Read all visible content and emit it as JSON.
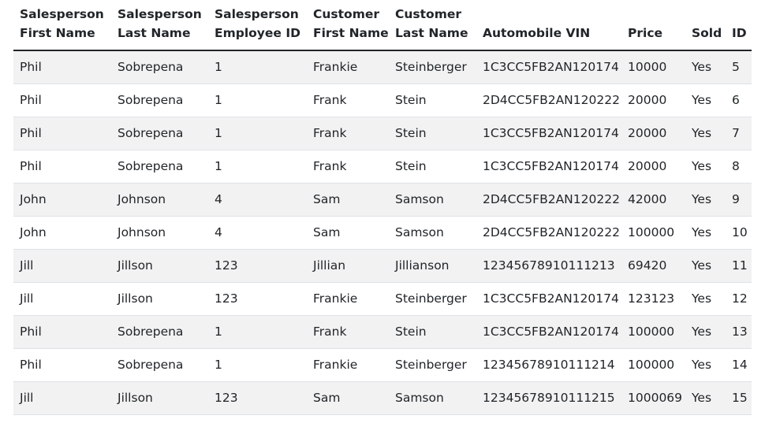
{
  "table": {
    "headers": [
      [
        "Salesperson",
        "First Name"
      ],
      [
        "Salesperson",
        "Last Name"
      ],
      [
        "Salesperson",
        "Employee ID"
      ],
      [
        "Customer",
        "First Name"
      ],
      [
        "Customer",
        "Last Name"
      ],
      [
        "",
        "Automobile VIN"
      ],
      [
        "",
        "Price"
      ],
      [
        "",
        "Sold"
      ],
      [
        "",
        "ID"
      ]
    ],
    "rows": [
      [
        "Phil",
        "Sobrepena",
        "1",
        "Frankie",
        "Steinberger",
        "1C3CC5FB2AN120174",
        "10000",
        "Yes",
        "5"
      ],
      [
        "Phil",
        "Sobrepena",
        "1",
        "Frank",
        "Stein",
        "2D4CC5FB2AN120222",
        "20000",
        "Yes",
        "6"
      ],
      [
        "Phil",
        "Sobrepena",
        "1",
        "Frank",
        "Stein",
        "1C3CC5FB2AN120174",
        "20000",
        "Yes",
        "7"
      ],
      [
        "Phil",
        "Sobrepena",
        "1",
        "Frank",
        "Stein",
        "1C3CC5FB2AN120174",
        "20000",
        "Yes",
        "8"
      ],
      [
        "John",
        "Johnson",
        "4",
        "Sam",
        "Samson",
        "2D4CC5FB2AN120222",
        "42000",
        "Yes",
        "9"
      ],
      [
        "John",
        "Johnson",
        "4",
        "Sam",
        "Samson",
        "2D4CC5FB2AN120222",
        "100000",
        "Yes",
        "10"
      ],
      [
        "Jill",
        "Jillson",
        "123",
        "Jillian",
        "Jillianson",
        "12345678910111213",
        "69420",
        "Yes",
        "11"
      ],
      [
        "Jill",
        "Jillson",
        "123",
        "Frankie",
        "Steinberger",
        "1C3CC5FB2AN120174",
        "123123",
        "Yes",
        "12"
      ],
      [
        "Phil",
        "Sobrepena",
        "1",
        "Frank",
        "Stein",
        "1C3CC5FB2AN120174",
        "100000",
        "Yes",
        "13"
      ],
      [
        "Phil",
        "Sobrepena",
        "1",
        "Frankie",
        "Steinberger",
        "12345678910111214",
        "100000",
        "Yes",
        "14"
      ],
      [
        "Jill",
        "Jillson",
        "123",
        "Sam",
        "Samson",
        "12345678910111215",
        "1000069",
        "Yes",
        "15"
      ]
    ]
  }
}
